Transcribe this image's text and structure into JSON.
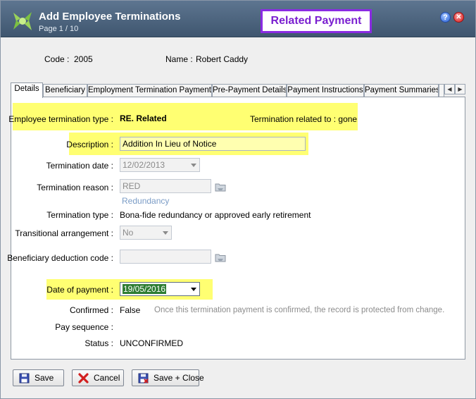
{
  "window": {
    "title": "Add Employee Terminations",
    "subtitle": "Page 1 / 10",
    "callout": "Related Payment",
    "help_glyph": "?",
    "close_glyph": "✕"
  },
  "header": {
    "code_label": "Code :",
    "code_value": "2005",
    "name_label": "Name :",
    "name_value": "Robert Caddy"
  },
  "tabs": [
    {
      "label": "Details",
      "active": true
    },
    {
      "label": "Beneficiary"
    },
    {
      "label": "Employment Termination Payments"
    },
    {
      "label": "Pre-Payment Details"
    },
    {
      "label": "Payment Instructions"
    },
    {
      "label": "Payment Summaries"
    },
    {
      "label": ""
    }
  ],
  "tab_scroll": {
    "left": "◀",
    "right": "▶"
  },
  "form": {
    "type_label": "Employee termination type :",
    "type_value": "RE. Related",
    "related_to": "Termination related to : gone",
    "description_label": "Description :",
    "description_value": "Addition In Lieu of Notice",
    "termination_date_label": "Termination date :",
    "termination_date_value": "12/02/2013",
    "termination_reason_label": "Termination reason :",
    "termination_reason_value": "RED",
    "termination_reason_desc": "Redundancy",
    "termination_type_label": "Termination type :",
    "termination_type_value": "Bona-fide redundancy or approved early retirement",
    "transitional_label": "Transitional arrangement :",
    "transitional_value": "No",
    "beneficiary_code_label": "Beneficiary deduction code :",
    "beneficiary_code_value": "",
    "date_of_payment_label": "Date of payment :",
    "date_of_payment_value": "19/05/2016",
    "confirmed_label": "Confirmed :",
    "confirmed_value": "False",
    "confirmed_note": "Once this termination payment is confirmed, the record is protected from change.",
    "pay_sequence_label": "Pay sequence :",
    "pay_sequence_value": "",
    "status_label": "Status :",
    "status_value": "UNCONFIRMED"
  },
  "buttons": {
    "save": "Save",
    "cancel": "Cancel",
    "save_close": "Save + Close"
  },
  "colors": {
    "highlight": "#ffff72",
    "titlebar": "#4a627c",
    "callout_border": "#8a2be2",
    "selected_date_bg": "#2e7d32"
  }
}
